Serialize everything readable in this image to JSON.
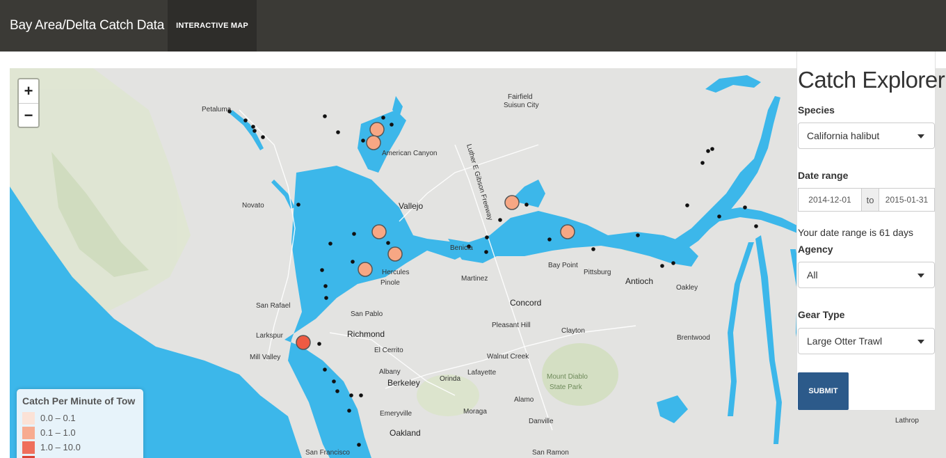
{
  "navbar": {
    "brand": "Bay Area/Delta Catch Data",
    "tab": "INTERACTIVE MAP"
  },
  "map": {
    "zoom_in": "+",
    "zoom_out": "−",
    "colors": {
      "water": "#3cb7ea",
      "land": "#e3e3e1",
      "park": "#d4dfc4"
    },
    "places": {
      "petaluma": "Petaluma",
      "fairfield": "Fairfield",
      "suisun_city": "Suisun City",
      "american_canyon": "American Canyon",
      "novato": "Novato",
      "vallejo": "Vallejo",
      "benicia": "Benicia",
      "hercules": "Hercules",
      "pinole": "Pinole",
      "martinez": "Martinez",
      "bay_point": "Bay Point",
      "pittsburg": "Pittsburg",
      "antioch": "Antioch",
      "oakley": "Oakley",
      "san_rafael": "San Rafael",
      "san_pablo": "San Pablo",
      "concord": "Concord",
      "larkspur": "Larkspur",
      "richmond": "Richmond",
      "pleasant_hill": "Pleasant Hill",
      "clayton": "Clayton",
      "brentwood": "Brentwood",
      "mill_valley": "Mill Valley",
      "el_cerrito": "El Cerrito",
      "walnut_creek": "Walnut Creek",
      "albany": "Albany",
      "berkeley": "Berkeley",
      "orinda": "Orinda",
      "lafayette": "Lafayette",
      "mount_diablo_1": "Mount Diablo",
      "mount_diablo_2": "State Park",
      "alamo": "Alamo",
      "emeryville": "Emeryville",
      "moraga": "Moraga",
      "danville": "Danville",
      "oakland": "Oakland",
      "san_francisco": "San Francisco",
      "san_ramon": "San Ramon",
      "lathrop": "Lathrop",
      "freeway": "Luther E Gibson Freeway"
    }
  },
  "legend": {
    "title": "Catch Per Minute of Tow",
    "items": [
      {
        "label": "0.0 – 0.1",
        "color": "#fde0d2"
      },
      {
        "label": "0.1 – 1.0",
        "color": "#f8a384"
      },
      {
        "label": "1.0 – 10.0",
        "color": "#f0604a"
      },
      {
        "label": "",
        "color": "#d7301f"
      }
    ]
  },
  "panel": {
    "title": "Catch Explorer",
    "species_label": "Species",
    "species_value": "California halibut",
    "date_label": "Date range",
    "date_start": "2014-12-01",
    "date_to": "to",
    "date_end": "2015-01-31",
    "range_text": "Your date range is 61 days",
    "agency_label": "Agency",
    "agency_value": "All",
    "gear_label": "Gear Type",
    "gear_value": "Large Otter Trawl",
    "submit_label": "SUBMIT"
  }
}
